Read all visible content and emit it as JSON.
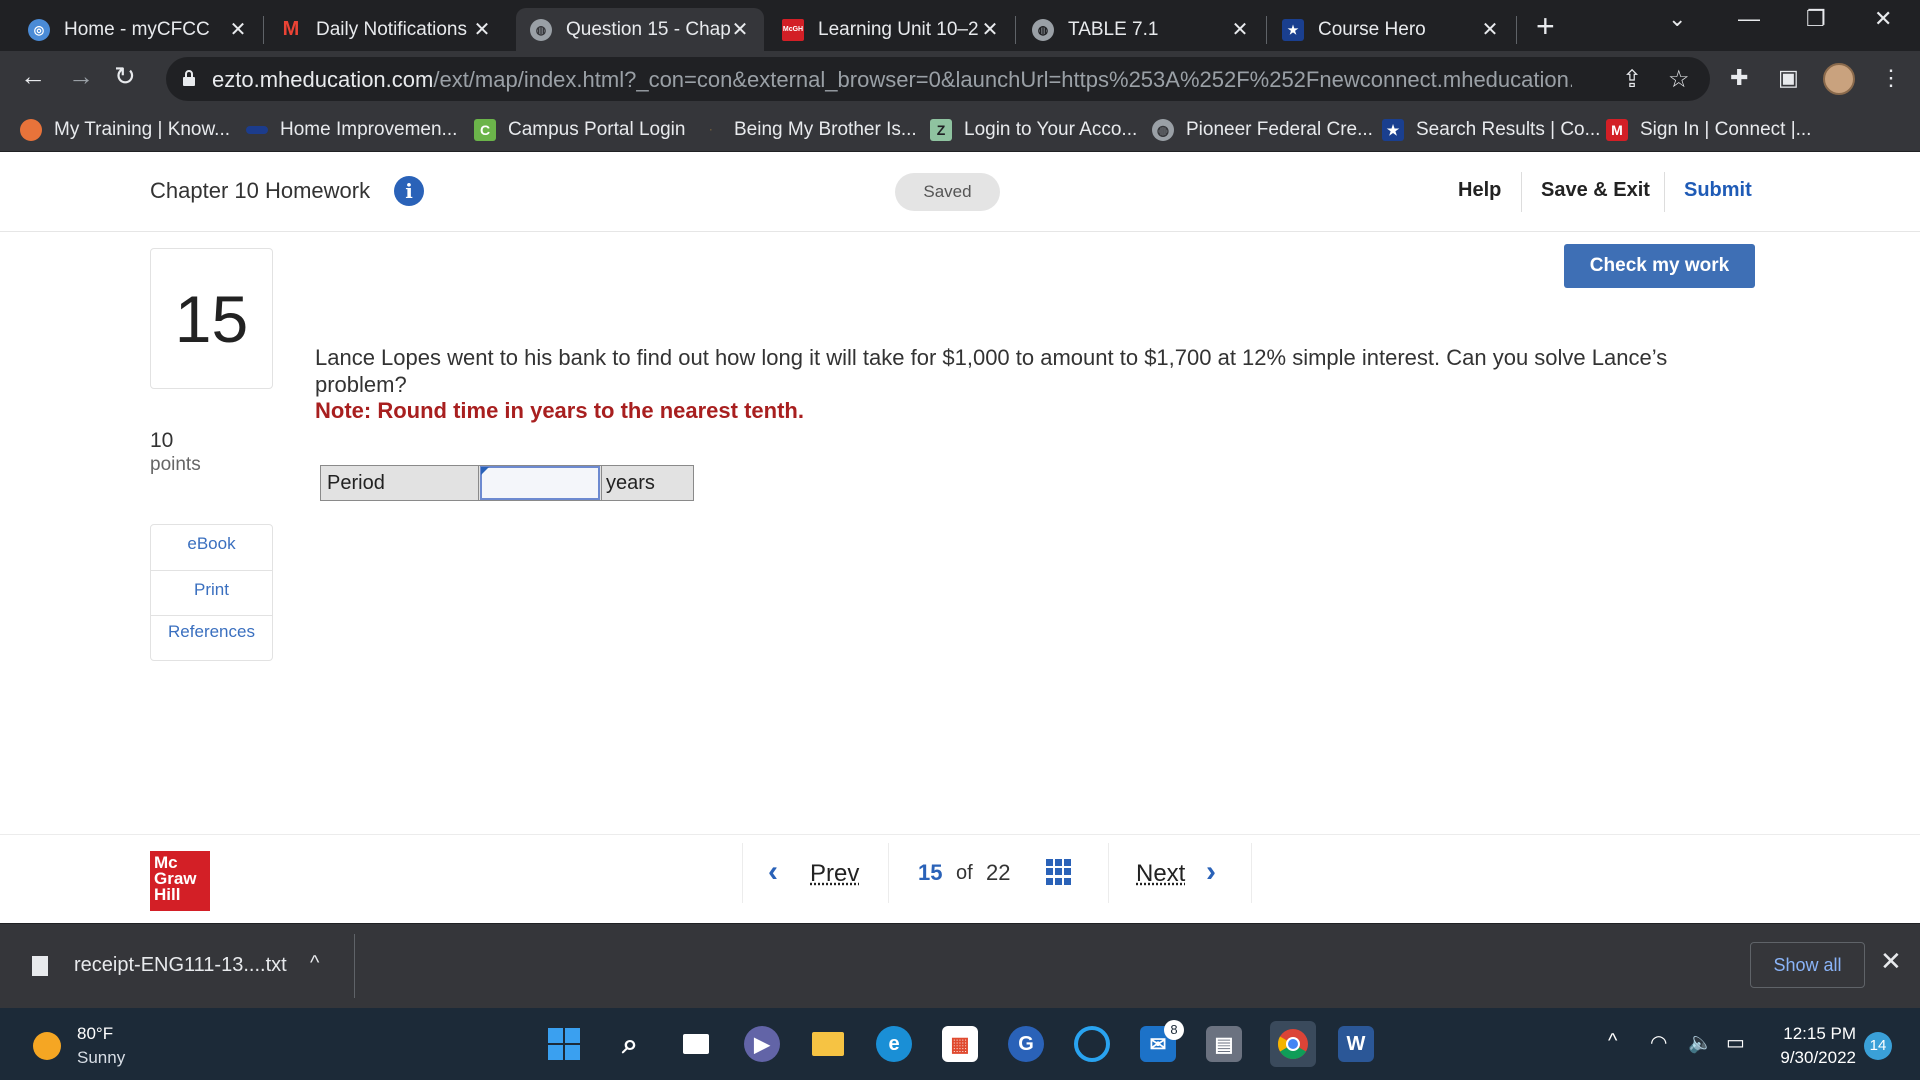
{
  "browser": {
    "tabs": [
      {
        "title": "Home - myCFCC",
        "icon": "mycfcc-icon",
        "close": "✕"
      },
      {
        "title": "Daily Notifications",
        "icon": "gmail-icon",
        "close": "✕"
      },
      {
        "title": "Question 15 - Chap",
        "icon": "globe-icon",
        "close": "✕"
      },
      {
        "title": "Learning Unit 10–2",
        "icon": "mcgraw-hill-icon",
        "close": "✕"
      },
      {
        "title": "TABLE 7.1",
        "icon": "globe-icon",
        "close": "✕"
      },
      {
        "title": "Course Hero",
        "icon": "star-icon",
        "close": "✕"
      }
    ],
    "active_tab": 2,
    "url_host": "ezto.mheducation.com",
    "url_path": "/ext/map/index.html?_con=con&external_browser=0&launchUrl=https%253A%252F%252Fnewconnect.mheducation.com%25...",
    "bookmarks": [
      "My Training | Know...",
      "Home Improvemen...",
      "Campus Portal Login",
      "Being My Brother Is...",
      "Login to Your Acco...",
      "Pioneer Federal Cre...",
      "Search Results | Co...",
      "Sign In | Connect |..."
    ]
  },
  "header": {
    "assignment_title": "Chapter 10 Homework",
    "status": "Saved",
    "help_label": "Help",
    "save_exit_label": "Save & Exit",
    "submit_label": "Submit"
  },
  "question": {
    "number": "15",
    "points_value": "10",
    "points_label": "points",
    "check_label": "Check my work",
    "text": "Lance Lopes went to his bank to find out how long it will take for $1,000 to amount to $1,700 at 12% simple interest. Can you solve Lance’s problem?",
    "note": "Note: Round time in years to the nearest tenth.",
    "answer": {
      "label": "Period",
      "value": "",
      "unit": "years"
    }
  },
  "side_links": [
    "eBook",
    "Print",
    "References"
  ],
  "footer": {
    "logo_lines": [
      "Mc",
      "Graw",
      "Hill"
    ],
    "prev_label": "Prev",
    "next_label": "Next",
    "current": "15",
    "of_label": "of",
    "total": "22"
  },
  "download": {
    "file_name": "receipt-ENG111-13....txt",
    "show_all": "Show all"
  },
  "taskbar": {
    "temperature": "80°F",
    "condition": "Sunny",
    "time": "12:15 PM",
    "date": "9/30/2022",
    "notification_count": "14",
    "mail_badge": "8"
  },
  "colors": {
    "accent": "#2a62b8",
    "note_red": "#a81f1f",
    "check_button": "#3e6fb5",
    "brand_red": "#d31f26"
  }
}
